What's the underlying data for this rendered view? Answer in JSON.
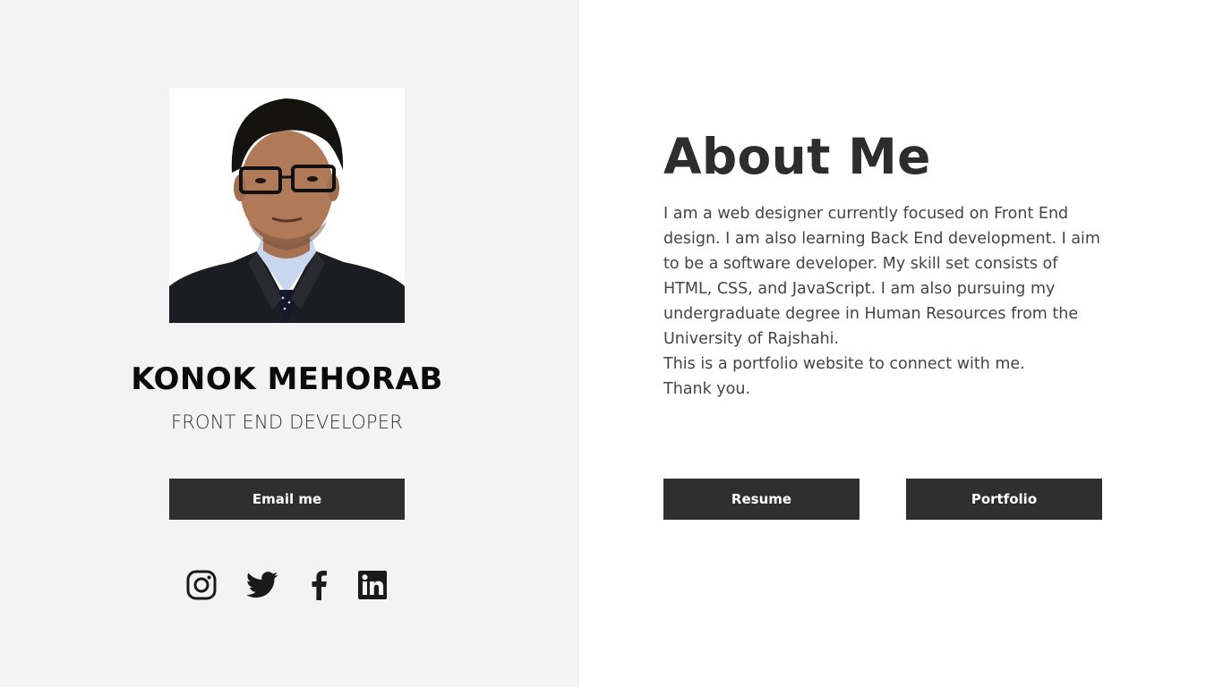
{
  "profile": {
    "name": "KONOK MEHORAB",
    "role": "FRONT END DEVELOPER",
    "email_button": "Email me"
  },
  "socials": [
    {
      "icon": "instagram-icon"
    },
    {
      "icon": "twitter-icon"
    },
    {
      "icon": "facebook-icon"
    },
    {
      "icon": "linkedin-icon"
    }
  ],
  "about": {
    "title": "About Me",
    "paragraph": "I am a web designer currently focused on Front End design. I am also learning Back End development. I aim to be a software developer. My skill set consists of HTML, CSS, and JavaScript. I am also pursuing my undergraduate degree in Human Resources from the University of Rajshahi.",
    "line2": "This is a portfolio website to connect with me.",
    "line3": "Thank you."
  },
  "buttons": {
    "resume": "Resume",
    "portfolio": "Portfolio"
  },
  "colors": {
    "left_bg": "#f3f3f3",
    "right_bg": "#ffffff",
    "button_bg": "#2f2f2f",
    "button_text": "#ffffff",
    "heading": "#2d2d2d"
  }
}
